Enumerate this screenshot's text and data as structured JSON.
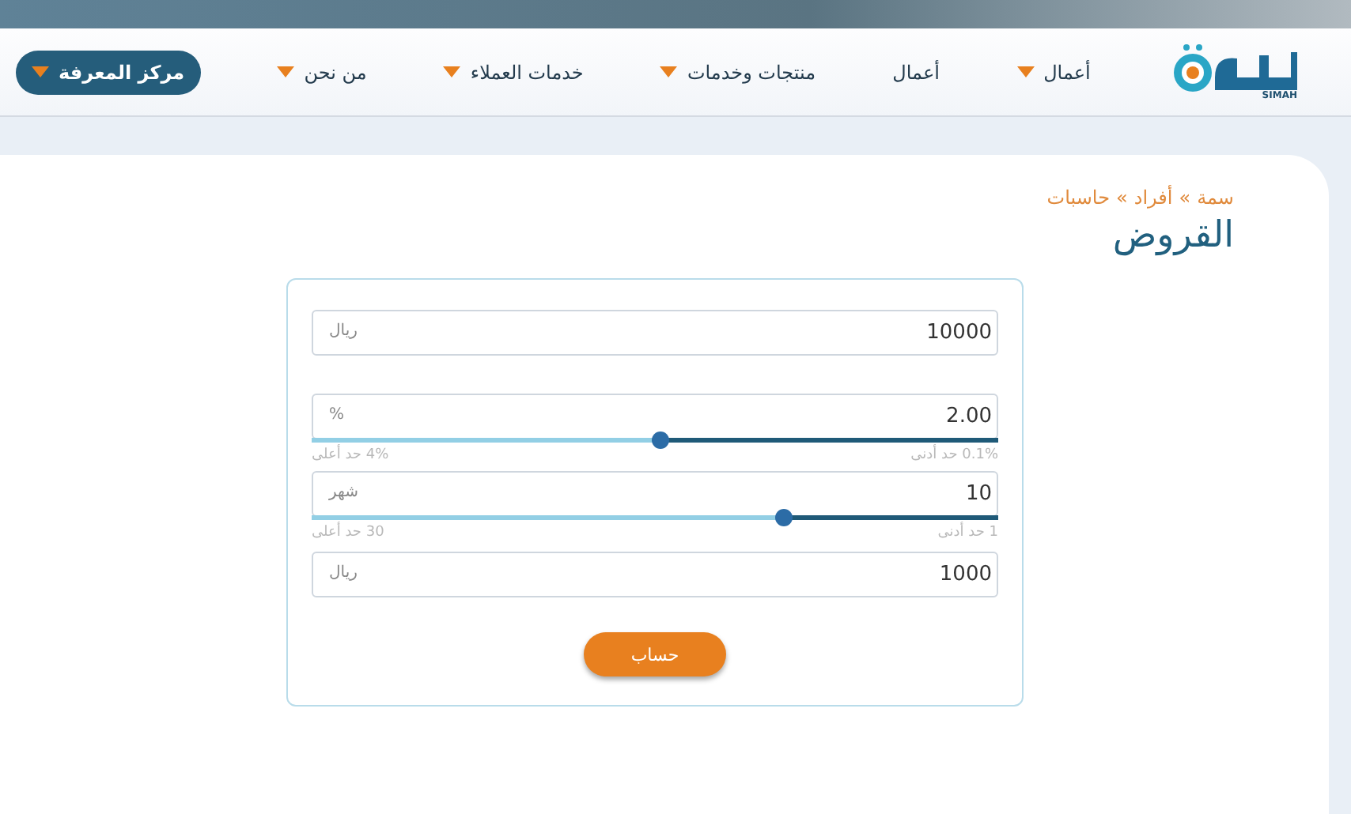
{
  "header": {
    "logo_caption": "SIMAH",
    "nav": [
      {
        "label": "أعمال",
        "kind": "dropdown"
      },
      {
        "label": "أعمال",
        "kind": "link"
      },
      {
        "label": "منتجات وخدمات",
        "kind": "dropdown"
      },
      {
        "label": "خدمات العملاء",
        "kind": "dropdown"
      },
      {
        "label": "من نحن",
        "kind": "dropdown"
      },
      {
        "label": "مركز المعرفة",
        "kind": "button"
      }
    ]
  },
  "breadcrumb": {
    "items": [
      "سمة",
      "أفراد",
      "حاسبات"
    ],
    "separator": "»"
  },
  "title": "القروض",
  "form": {
    "fields": [
      {
        "kind": "input",
        "value": "10000",
        "unit": "ريال"
      },
      {
        "kind": "slider",
        "value": "2.00",
        "unit": "%",
        "level": 0.49,
        "min_label": "0.1% حد أدنى",
        "max_label": "4% حد أعلى"
      },
      {
        "kind": "slider",
        "value": "10",
        "unit": "شهر",
        "level": 0.31,
        "min_label": "1 حد أدنى",
        "max_label": "30 حد أعلى"
      },
      {
        "kind": "input",
        "value": "1000",
        "unit": "ريال"
      }
    ],
    "submit": "حساب"
  }
}
